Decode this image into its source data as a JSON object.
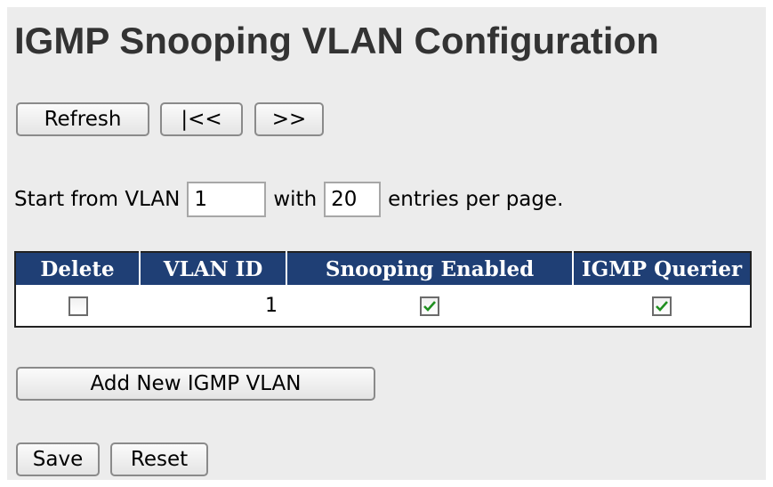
{
  "page_title": "IGMP Snooping VLAN Configuration",
  "nav": {
    "refresh_label": "Refresh",
    "first_label": "|<<",
    "next_label": ">>"
  },
  "paging": {
    "start_prefix": "Start from VLAN",
    "start_value": "1",
    "with_label": "with",
    "entries_value": "20",
    "entries_suffix": "entries per page."
  },
  "table": {
    "headers": [
      "Delete",
      "VLAN ID",
      "Snooping Enabled",
      "IGMP Querier"
    ],
    "rows": [
      {
        "delete": false,
        "vlan_id": "1",
        "snooping_enabled": true,
        "igmp_querier": true
      }
    ]
  },
  "actions": {
    "add_label": "Add New IGMP VLAN",
    "save_label": "Save",
    "reset_label": "Reset"
  },
  "colors": {
    "header_bg": "#1f3f75",
    "check": "#1f8f1f"
  }
}
